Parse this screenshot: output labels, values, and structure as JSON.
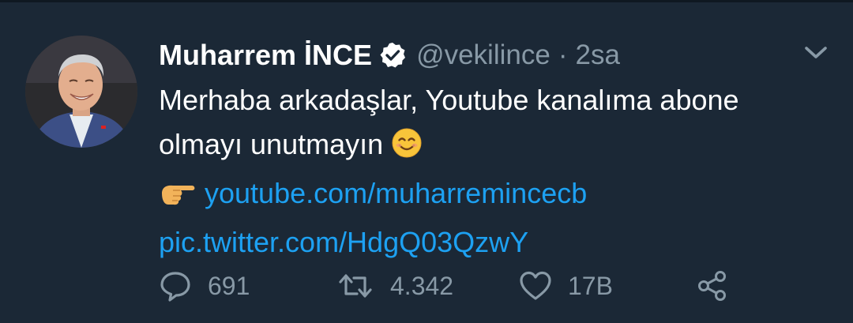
{
  "tweet": {
    "display_name": "Muharrem İNCE",
    "handle": "@vekilince",
    "separator": "·",
    "time": "2sa",
    "text_line1": "Merhaba arkadaşlar, Youtube kanalıma abone",
    "text_line2": "olmayı unutmayın",
    "emoji_smile": "smiling-face-icon",
    "emoji_point": "pointing-hand-icon",
    "link_youtube": "youtube.com/muharremincecb",
    "link_pic": "pic.twitter.com/HdgQ03QzwY"
  },
  "actions": {
    "reply_icon": "reply-icon",
    "reply_count": "691",
    "retweet_icon": "retweet-icon",
    "retweet_count": "4.342",
    "like_icon": "heart-icon",
    "like_count": "17B",
    "share_icon": "share-icon"
  },
  "colors": {
    "background": "#1b2836",
    "text": "#ffffff",
    "secondary": "#8899a6",
    "link": "#1da1f2"
  }
}
